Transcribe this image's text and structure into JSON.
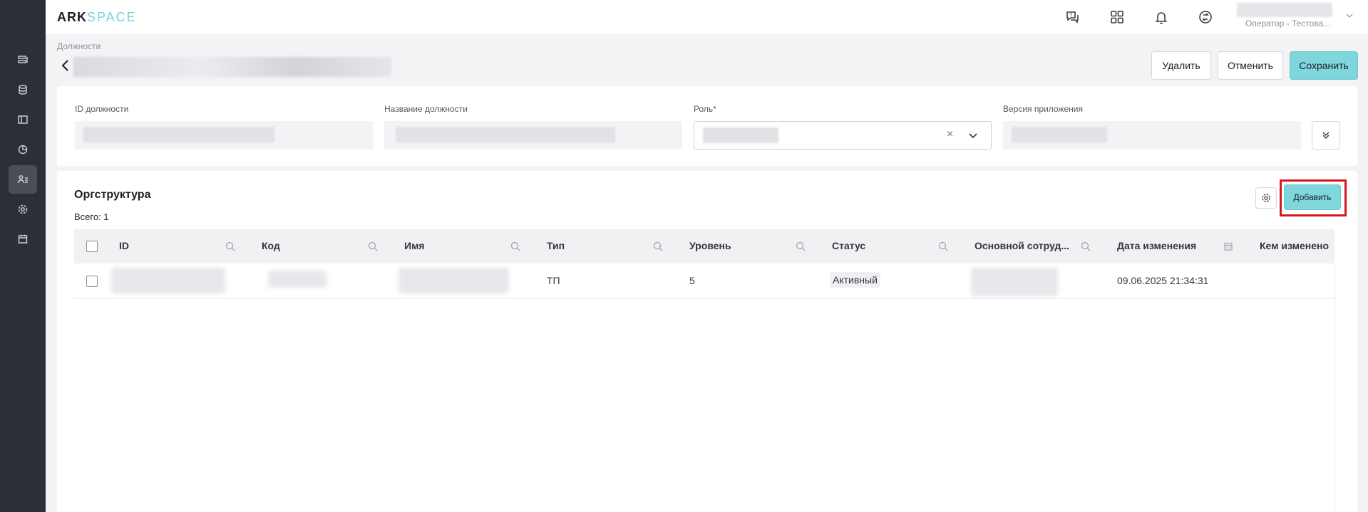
{
  "app": {
    "logo_primary": "ARK",
    "logo_secondary": "SPACE"
  },
  "topbar": {
    "icons": [
      "chat-help-icon",
      "apps-grid-icon",
      "bell-icon",
      "sync-icon"
    ],
    "user_role": "Оператор - Тестова..."
  },
  "sidebar": {
    "icons": [
      "list-icon",
      "database-icon",
      "layout-icon",
      "chart-icon",
      "users-icon",
      "settings-icon",
      "calendar-icon"
    ],
    "active_index": 4
  },
  "page": {
    "breadcrumb": "Должности",
    "actions": {
      "delete_label": "Удалить",
      "cancel_label": "Отменить",
      "save_label": "Сохранить"
    }
  },
  "form": {
    "id_label": "ID должности",
    "name_label": "Название должности",
    "role_label": "Роль*",
    "version_label": "Версия приложения",
    "clear_symbol": "×"
  },
  "org": {
    "title": "Оргструктура",
    "total": "Всего: 1",
    "add_label": "Добавить",
    "columns": [
      "ID",
      "Код",
      "Имя",
      "Тип",
      "Уровень",
      "Статус",
      "Основной сотруд...",
      "Дата изменения",
      "Кем изменено"
    ],
    "rows": [
      {
        "type": "ТП",
        "level": "5",
        "status": "Активный",
        "modified_at": "09.06.2025 21:34:31"
      }
    ]
  }
}
